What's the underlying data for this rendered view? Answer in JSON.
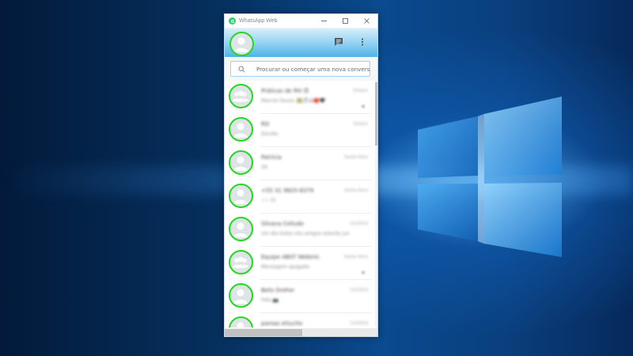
{
  "window": {
    "title": "WhatsApp Web"
  },
  "search": {
    "placeholder": "Procurar ou começar uma nova conversa",
    "value": ""
  },
  "icons": {
    "app": "whatsapp-icon",
    "minimize": "minimize-icon",
    "maximize": "maximize-icon",
    "close": "close-icon",
    "new_chat": "chat-icon",
    "menu": "more-vertical-icon",
    "search": "search-icon"
  },
  "colors": {
    "accent": "#23d922",
    "header_gradient_end": "#4fb3e8"
  },
  "chats": [
    {
      "name": "Práticas de RH 😊",
      "time": "Ontem",
      "message": "Marcos Souza: 🖼️🎵😀🔴🖤",
      "group": true,
      "muted": true
    },
    {
      "name": "RD",
      "time": "Ontem",
      "message": "Dúvida",
      "group": false,
      "muted": false
    },
    {
      "name": "Patrícia",
      "time": "Sexta-feira",
      "message": "Ok",
      "group": false,
      "muted": false
    },
    {
      "name": "+55 31 9825-8379",
      "time": "Sexta-feira",
      "message": "✓✓ Oi",
      "group": false,
      "muted": false
    },
    {
      "name": "Silvana Celiudo",
      "time": "12/2019",
      "message": "Um dia todos nós amigos estarão juntos",
      "group": false,
      "muted": false
    },
    {
      "name": "Equipe ABST Webinic",
      "time": "Sexta-feira",
      "message": "Mensagem apagada",
      "group": true,
      "muted": true
    },
    {
      "name": "Beto Dreher",
      "time": "12/2019",
      "message": "Foto 📷",
      "group": false,
      "muted": false
    },
    {
      "name": "paroas etiucito",
      "time": "12/2019",
      "message": "",
      "group": false,
      "muted": false
    }
  ]
}
